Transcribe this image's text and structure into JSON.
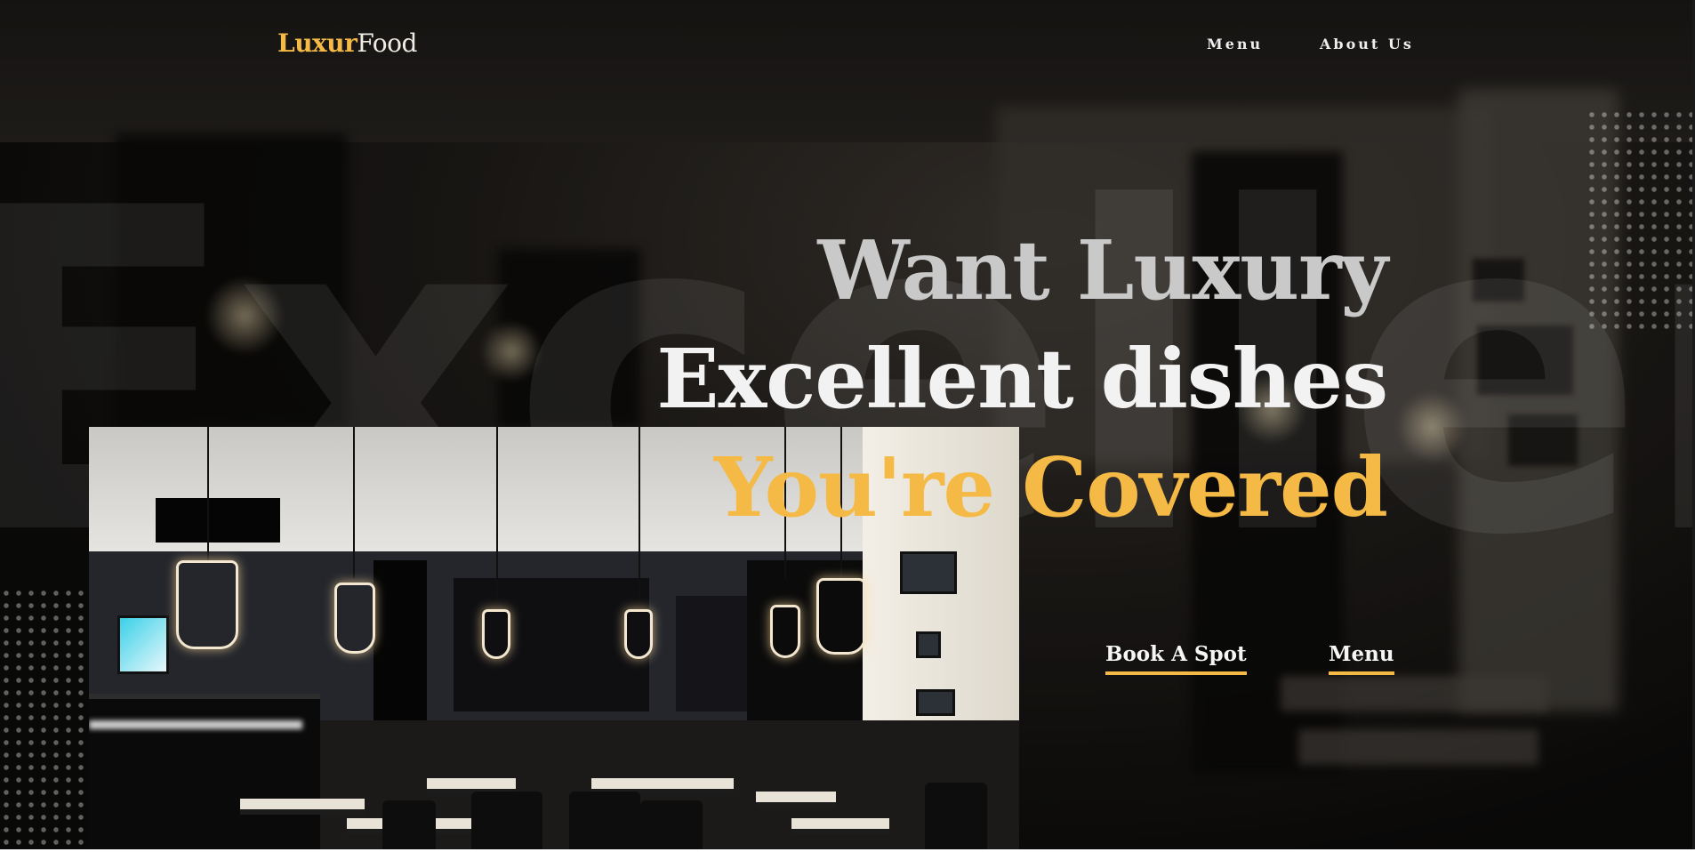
{
  "brand": {
    "logo_part1": "Luxur",
    "logo_part2": "Food",
    "accent_color": "#f5b945"
  },
  "nav": {
    "items": [
      {
        "label": "Menu"
      },
      {
        "label": "About Us"
      }
    ]
  },
  "hero": {
    "background_word": "Excellent",
    "headline": {
      "line1": "Want Luxury",
      "line2": "Excellent dishes",
      "line3": "You're Covered"
    },
    "cta": {
      "primary_label": "Book A Spot",
      "secondary_label": "Menu"
    }
  },
  "icons": {
    "photo": "restaurant-interior-image",
    "pattern": "dot-grid-pattern"
  }
}
